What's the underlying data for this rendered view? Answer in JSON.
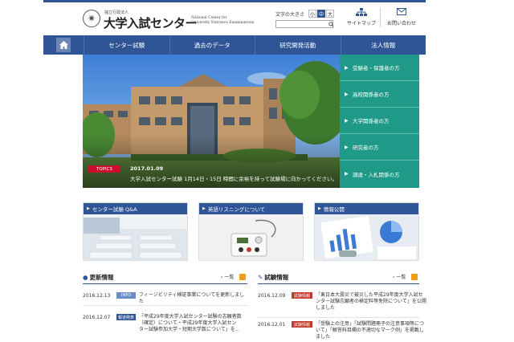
{
  "header": {
    "org_type": "独立行政法人",
    "logo_main": "大学入試センター",
    "logo_en_1": "National Center for",
    "logo_en_2": "University Entrance Examinations",
    "font_size_label": "文字の大きさ",
    "font_sizes": [
      "小",
      "中",
      "大"
    ],
    "font_size_selected": "中",
    "search_placeholder": "",
    "sitemap_label": "サイトマップ",
    "contact_label": "お問い合わせ"
  },
  "nav": {
    "items": [
      "センター試験",
      "過去のデータ",
      "研究開発活動",
      "法人情報"
    ]
  },
  "hero": {
    "topics_badge": "TOPICS",
    "topics_date": "2017.01.09",
    "topics_text": "大学入試センター試験 1月14日・15日 時間に余裕を持って試験場に向かってください。"
  },
  "side_menu": {
    "items": [
      "受験者・保護者の方",
      "高校関係者の方",
      "大学関係者の方",
      "研究者の方",
      "調達・入札関係の方"
    ]
  },
  "cards": [
    {
      "label": "センター試験 Q&A"
    },
    {
      "label": "英語リスニングについて"
    },
    {
      "label": "情報公開"
    }
  ],
  "news": {
    "title": "更新情報",
    "list_label": "一覧",
    "items": [
      {
        "date": "2016.12.13",
        "tag": "INFO",
        "tag_color": "#6a8fc7",
        "text": "フィージビリティ検証事業についてを更新しました"
      },
      {
        "date": "2016.12.07",
        "tag": "報道発表",
        "tag_color": "#2f5597",
        "text_1": "「平成29年度大学入試センター試験の志願者数",
        "text_2": "（確定）について・平成29年度大学入試セン",
        "text_3": "ター試験参加大学・短期大学数について」を..."
      }
    ]
  },
  "exam": {
    "title": "試験情報",
    "list_label": "一覧",
    "items": [
      {
        "date": "2016.12.09",
        "tag": "試験情報",
        "tag_color": "#c0392b",
        "text_1": "「東日本大震災で被災した平成29年度大学入試セ",
        "text_2": "ンター試験志願者の検定料等免除について」を公開",
        "text_3": "しました"
      },
      {
        "date": "2016.12.01",
        "tag": "試験情報",
        "tag_color": "#c0392b",
        "text_1": "「受験上の注意」「試験問題冊子の注意事項等につ",
        "text_2": "いて」「解答科目欄の不適切なマーク例」を掲載し",
        "text_3": "ました"
      }
    ]
  },
  "colors": {
    "brand": "#2f5597",
    "side": "#1f9a88",
    "topics": "#c8102e",
    "rss": "#f39c12"
  }
}
